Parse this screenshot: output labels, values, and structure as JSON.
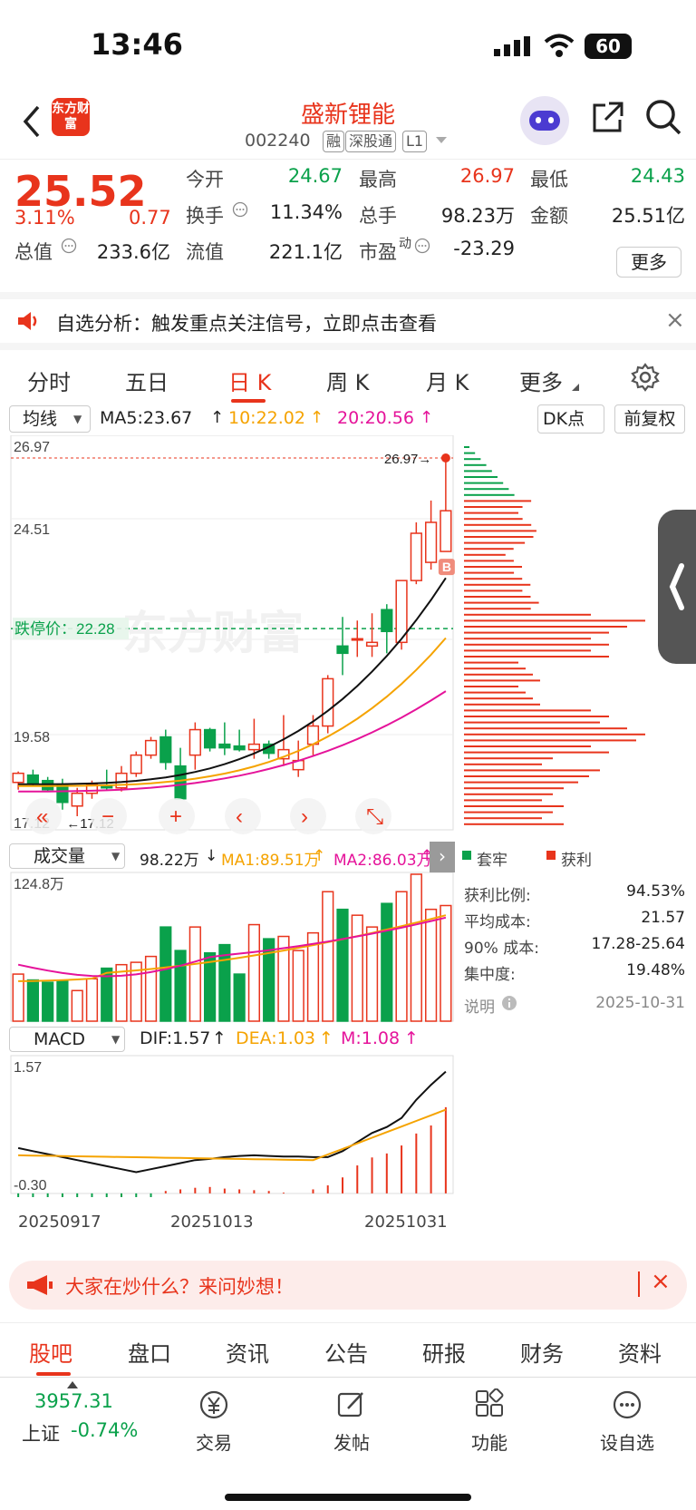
{
  "status_bar": {
    "time": "13:46",
    "battery": "60"
  },
  "header": {
    "back_icon": "chevron-left-icon",
    "logo_text": "东方财富",
    "stock_name": "盛新锂能",
    "stock_code": "002240",
    "tags": [
      "融",
      "深股通",
      "L1"
    ],
    "share_icon": "share-icon",
    "search_icon": "search-icon"
  },
  "quote": {
    "price": "25.52",
    "change_pct": "3.11%",
    "change_abs": "0.77",
    "open_label": "今开",
    "open": "24.67",
    "high_label": "最高",
    "high": "26.97",
    "low_label": "最低",
    "low": "24.43",
    "turnover_label": "换手",
    "turnover": "11.34%",
    "volume_label": "总手",
    "volume": "98.23万",
    "amount_label": "金额",
    "amount": "25.51亿",
    "mktcap_label": "总值",
    "mktcap": "233.6亿",
    "float_label": "流值",
    "float": "221.1亿",
    "pe_label": "市盈",
    "pe_sup": "动",
    "pe": "-23.29",
    "more_button": "更多"
  },
  "banner": {
    "text": "自选分析：触发重点关注信号，立即点击查看",
    "close": "×"
  },
  "period_tabs": [
    "分时",
    "五日",
    "日 K",
    "周 K",
    "月 K",
    "更多"
  ],
  "chart_toolbar": {
    "ma_select": "均线",
    "ma5": "MA5:23.67",
    "ma10": "10:22.02",
    "ma20": "20:20.56",
    "dk_button": "DK点",
    "adjust_button": "前复权"
  },
  "chart_labels": {
    "high_price": "26.97",
    "mid_price": "24.51",
    "low_price_axis": "19.58",
    "bottom_price": "17.12",
    "high_marker": "26.97",
    "low_marker": "17.12",
    "stop_line": "跌停价：22.28",
    "watermark": "东方财富",
    "b_marker": "B"
  },
  "volume_toolbar": {
    "select": "成交量",
    "vol": "98.22万",
    "ma1": "MA1:89.51万",
    "ma2": "MA2:86.03万",
    "axis_top": "124.8万"
  },
  "macd_toolbar": {
    "select": "MACD",
    "dif": "DIF:1.57",
    "dea": "DEA:1.03",
    "m": "M:1.08",
    "axis_top": "1.57",
    "axis_bottom": "-0.30"
  },
  "dates": [
    "20250917",
    "20251013",
    "20251031"
  ],
  "chip_panel": {
    "legend_trapped": "套牢",
    "legend_profit": "获利",
    "rows": [
      {
        "label": "获利比例:",
        "value": "94.53%"
      },
      {
        "label": "平均成本:",
        "value": "21.57"
      },
      {
        "label": "90% 成本:",
        "value": "17.28-25.64"
      },
      {
        "label": "集中度:",
        "value": "19.48%"
      }
    ],
    "note": "说明",
    "date": "2025-10-31"
  },
  "ask_banner": {
    "text": "大家在炒什么？来问妙想！",
    "close": "×"
  },
  "bottom_tabs": [
    "股吧",
    "盘口",
    "资讯",
    "公告",
    "研报",
    "财务",
    "资料"
  ],
  "footer": {
    "index_value": "3957.31",
    "index_name": "上证",
    "index_change": "-0.74%",
    "items": [
      "交易",
      "发帖",
      "功能",
      "设自选"
    ]
  },
  "colors": {
    "up": "#e8341c",
    "down": "#0aa14b",
    "ma5": "#111111",
    "ma10": "#f5a300",
    "ma20": "#e5139a"
  },
  "chart_data": {
    "type": "candlestick",
    "ohlc": [
      [
        18.05,
        18.35,
        17.85,
        18.3
      ],
      [
        18.25,
        18.4,
        17.95,
        18.0
      ],
      [
        18.1,
        18.2,
        17.8,
        17.85
      ],
      [
        18.0,
        18.15,
        17.3,
        17.5
      ],
      [
        17.4,
        17.9,
        17.12,
        17.75
      ],
      [
        17.75,
        18.1,
        17.6,
        18.0
      ],
      [
        17.95,
        18.4,
        17.85,
        17.9
      ],
      [
        17.9,
        18.5,
        17.8,
        18.3
      ],
      [
        18.3,
        18.9,
        18.2,
        18.8
      ],
      [
        18.8,
        19.3,
        18.7,
        19.2
      ],
      [
        19.3,
        19.5,
        18.4,
        18.6
      ],
      [
        18.5,
        19.0,
        17.6,
        17.6
      ],
      [
        18.8,
        19.7,
        18.4,
        19.5
      ],
      [
        19.5,
        19.55,
        18.9,
        19.0
      ],
      [
        19.1,
        19.7,
        18.8,
        19.0
      ],
      [
        19.05,
        19.5,
        18.9,
        18.95
      ],
      [
        18.95,
        19.8,
        18.7,
        19.1
      ],
      [
        19.1,
        19.2,
        18.7,
        18.85
      ],
      [
        18.7,
        19.9,
        18.5,
        18.95
      ],
      [
        18.4,
        19.2,
        18.2,
        18.65
      ],
      [
        19.1,
        19.9,
        18.8,
        19.6
      ],
      [
        19.6,
        21.0,
        19.4,
        20.9
      ],
      [
        21.8,
        22.6,
        21.0,
        21.6
      ],
      [
        22.0,
        22.5,
        21.5,
        22.0
      ],
      [
        21.8,
        22.7,
        21.5,
        21.9
      ],
      [
        22.8,
        22.95,
        21.6,
        22.2
      ],
      [
        21.9,
        23.6,
        21.7,
        23.6
      ],
      [
        23.6,
        25.2,
        23.5,
        24.9
      ],
      [
        24.1,
        25.8,
        23.9,
        25.2
      ],
      [
        24.4,
        26.97,
        24.43,
        25.52
      ]
    ],
    "ma5_start": 18.0,
    "ma5_end": 23.67,
    "ma10_end": 22.02,
    "ma20_end": 20.56,
    "ylim": [
      17.12,
      26.97
    ],
    "volume": [
      40,
      35,
      33,
      34,
      26,
      36,
      45,
      48,
      50,
      55,
      80,
      60,
      80,
      58,
      65,
      40,
      82,
      70,
      72,
      60,
      75,
      110,
      95,
      90,
      80,
      100,
      110,
      124.8,
      95,
      98.22
    ],
    "macd_dif": [
      0.3,
      0.25,
      0.2,
      0.15,
      0.1,
      0.05,
      0.0,
      -0.05,
      -0.1,
      -0.05,
      0.0,
      0.05,
      0.1,
      0.12,
      0.15,
      0.17,
      0.18,
      0.17,
      0.16,
      0.16,
      0.15,
      0.15,
      0.25,
      0.4,
      0.55,
      0.65,
      0.8,
      1.1,
      1.35,
      1.57
    ],
    "macd_hist": [
      -0.18,
      -0.16,
      -0.15,
      -0.14,
      -0.13,
      -0.12,
      -0.1,
      -0.08,
      -0.07,
      -0.05,
      0.03,
      0.05,
      0.07,
      0.08,
      0.06,
      0.05,
      0.04,
      0.03,
      0.01,
      0.0,
      0.05,
      0.1,
      0.2,
      0.35,
      0.45,
      0.5,
      0.6,
      0.75,
      0.85,
      1.08
    ]
  }
}
